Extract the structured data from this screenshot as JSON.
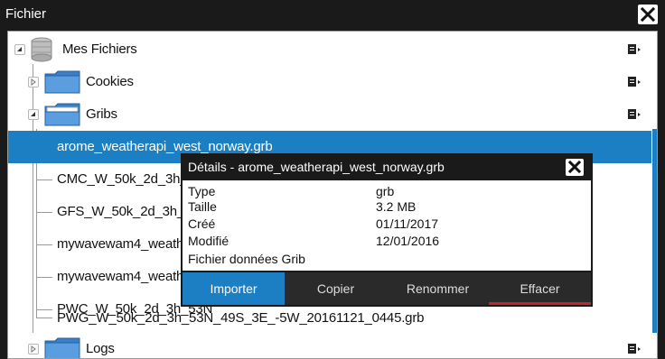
{
  "window": {
    "title": "Fichier",
    "close_icon": "close-icon"
  },
  "tree": {
    "root": {
      "label": "Mes Fichiers",
      "icon": "storage-icon",
      "expanded": true
    },
    "folders": [
      {
        "label": "Cookies",
        "icon": "folder-icon",
        "expanded": false
      },
      {
        "label": "Gribs",
        "icon": "folder-open-icon",
        "expanded": true
      },
      {
        "label": "Logs",
        "icon": "folder-icon",
        "expanded": false
      }
    ],
    "files": [
      "arome_weatherapi_west_norway.grb",
      "CMC_W_50k_2d_3h_53N",
      "GFS_W_50k_2d_3h_53N_",
      "mywavewam4_weather",
      "mywavewam4_weather",
      "PWC_W_50k_2d_3h_53N",
      "PWG_W_50k_2d_3h_53N_49S_3E_-5W_20161121_0445.grb"
    ],
    "selected_file": "arome_weatherapi_west_norway.grb"
  },
  "details": {
    "title": "Détails - arome_weatherapi_west_norway.grb",
    "rows": [
      {
        "key": "Type",
        "value": "grb"
      },
      {
        "key": "Taille",
        "value": "3.2 MB"
      },
      {
        "key": "Créé",
        "value": "01/11/2017"
      },
      {
        "key": "Modifié",
        "value": "12/01/2016"
      },
      {
        "key": "Fichier données Grib",
        "value": ""
      }
    ],
    "buttons": {
      "import": "Importer",
      "copy": "Copier",
      "rename": "Renommer",
      "delete": "Effacer"
    }
  },
  "colors": {
    "accent": "#1c7fc4",
    "frame": "#1a1a1a",
    "delete_underline": "#c4242a"
  }
}
